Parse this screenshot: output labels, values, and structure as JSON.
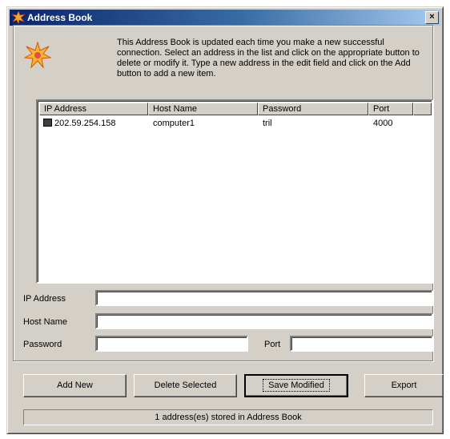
{
  "window": {
    "title": "Address Book",
    "close_glyph": "×"
  },
  "description": "This Address Book is updated each time you make a new successful connection. Select an address in the list and click on the appropriate button to delete or modify it. Type a new address in the edit field and click on the Add button to add a new item.",
  "table": {
    "columns": [
      "IP Address",
      "Host Name",
      "Password",
      "Port"
    ],
    "rows": [
      {
        "ip": "202.59.254.158",
        "host": "computer1",
        "password": "tril",
        "port": "4000"
      }
    ]
  },
  "form": {
    "ip_label": "IP Address",
    "ip_value": "",
    "host_label": "Host Name",
    "host_value": "",
    "password_label": "Password",
    "password_value": "",
    "port_label": "Port",
    "port_value": ""
  },
  "buttons": {
    "add_new": "Add New",
    "delete_selected": "Delete Selected",
    "save_modified": "Save Modified",
    "export": "Export"
  },
  "status": "1 address(es) stored in Address Book",
  "colors": {
    "title_active": "#0a246a",
    "face": "#d4d0c8",
    "icon_orange": "#f5a623"
  }
}
